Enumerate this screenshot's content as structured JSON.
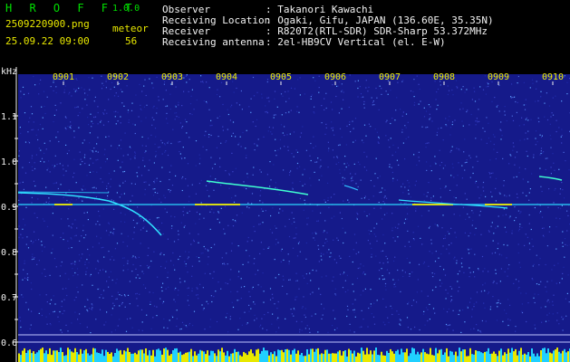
{
  "header": {
    "brand": "H R O F F T",
    "version": "1.0.0",
    "filename": "2509220900.png",
    "datetime": "25.09.22 09:00",
    "meteor_label": "meteor",
    "meteor_count": "56",
    "info": [
      {
        "label": "Observer",
        "value": ": Takanori Kawachi"
      },
      {
        "label": "Receiving Location",
        "value": ": Ogaki, Gifu, JAPAN (136.60E, 35.35N)"
      },
      {
        "label": "Receiver",
        "value": ": R820T2(RTL-SDR) SDR-Sharp 53.372MHz"
      },
      {
        "label": "Receiving antenna",
        "value": ": 2el-HB9CV Vertical (el. E-W)"
      }
    ]
  },
  "axis": {
    "unit": "kHz",
    "y_ticks": [
      "1.1",
      "1.0",
      "0.9",
      "0.8",
      "0.7",
      "0.6"
    ],
    "time_ticks": [
      "0901",
      "0902",
      "0903",
      "0904",
      "0905",
      "0906",
      "0907",
      "0908",
      "0909",
      "0910"
    ]
  },
  "colors": {
    "background": "#000000",
    "spectrum": "#151a8a",
    "header_text": "#e8e800",
    "brand": "#00e000",
    "signal": "#f2f200"
  }
}
